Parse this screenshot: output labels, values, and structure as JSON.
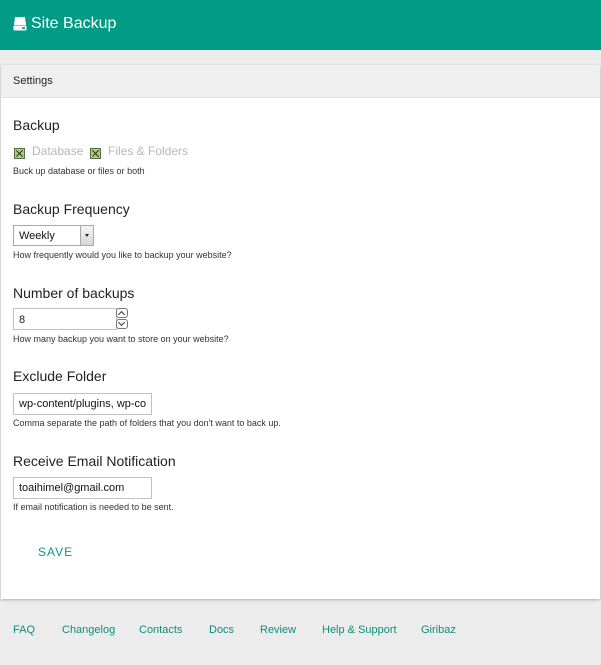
{
  "header": {
    "title": "Site Backup",
    "icon": "server-icon",
    "color": "#019b86"
  },
  "settings": {
    "panel_title": "Settings",
    "backup": {
      "title": "Backup",
      "options": [
        {
          "label": "Database",
          "checked": true
        },
        {
          "label": "Files & Folders",
          "checked": true
        }
      ],
      "help": "Buck up database or files or both"
    },
    "frequency": {
      "title": "Backup Frequency",
      "selected": "Weekly",
      "help": "How frequently would you like to backup your website?"
    },
    "number": {
      "title": "Number of backups",
      "value": "8",
      "help": "How many backup you want to store on your website?"
    },
    "exclude": {
      "title": "Exclude Folder",
      "value": "wp-content/plugins, wp-content/themes",
      "help": "Comma separate the path of folders that you don't want to back up."
    },
    "email": {
      "title": "Receive Email Notification",
      "value": "toaihimel@gmail.com",
      "help": "If email notification is needed to be sent."
    },
    "save_label": "SAVE"
  },
  "footer": {
    "links": [
      "FAQ",
      "Changelog",
      "Contacts",
      "Docs",
      "Review",
      "Help & Support",
      "Giribaz"
    ]
  },
  "colors": {
    "accent": "#0a9a86",
    "checkbox": "#a9cf7e"
  }
}
